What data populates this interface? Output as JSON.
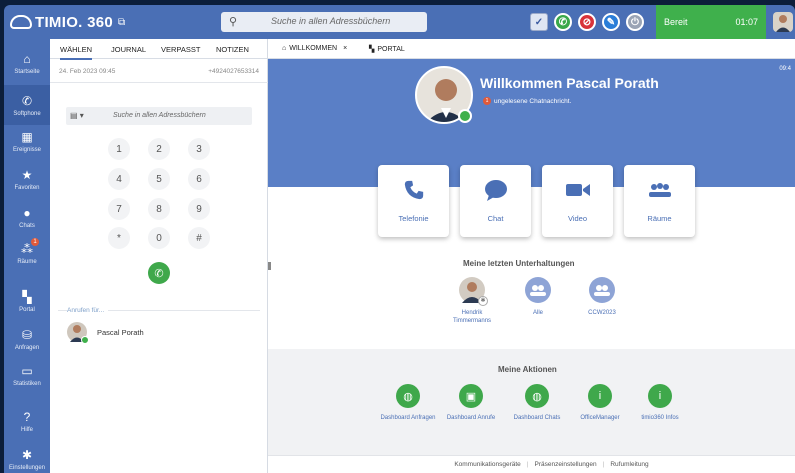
{
  "app": {
    "logo": "TIMIO. 360",
    "logo_ext_icon": "external-link-icon",
    "search_placeholder": "Suche in allen Adressbüchern"
  },
  "topbar": {
    "status_label": "Bereit",
    "timer": "01:07",
    "status_color": "#3fb04c",
    "bar_color": "#4a6fb5"
  },
  "nav": {
    "items": [
      {
        "label": "Startseite",
        "icon": "home-icon"
      },
      {
        "label": "Softphone",
        "icon": "phone-icon"
      },
      {
        "label": "Ereignisse",
        "icon": "calendar-icon"
      },
      {
        "label": "Favoriten",
        "icon": "star-icon"
      },
      {
        "label": "Chats",
        "icon": "chat-icon"
      },
      {
        "label": "Räume",
        "icon": "rooms-icon",
        "badge": "1"
      },
      {
        "label": "Portal",
        "icon": "grid-icon"
      },
      {
        "label": "Anfragen",
        "icon": "inbox-icon"
      },
      {
        "label": "Statistiken",
        "icon": "stats-icon"
      },
      {
        "label": "Hilfe",
        "icon": "help-icon"
      },
      {
        "label": "Einstellungen",
        "icon": "gear-icon"
      }
    ]
  },
  "dial": {
    "tabs": [
      "WÄHLEN",
      "JOURNAL",
      "VERPASST",
      "NOTIZEN"
    ],
    "last_date": "24. Feb 2023  09:45",
    "last_number": "+4924027653314",
    "search_placeholder": "Suche in allen Adressbüchern",
    "keys": [
      "1",
      "2",
      "3",
      "4",
      "5",
      "6",
      "7",
      "8",
      "9",
      "*",
      "0",
      "#"
    ],
    "call_for_label": "Anrufen für...",
    "call_for_name": "Pascal Porath"
  },
  "main": {
    "tabs": [
      {
        "label": "WILLKOMMEN",
        "icon": "home-icon",
        "close": "×"
      },
      {
        "label": "PORTAL",
        "icon": "grid-icon"
      }
    ],
    "time": "09:4",
    "welcome_title": "Willkommen Pascal Porath",
    "unread_badge": "1",
    "unread_text": "ungelesene Chatnachricht.",
    "cards": [
      {
        "label": "Telefonie",
        "icon": "phone-icon"
      },
      {
        "label": "Chat",
        "icon": "chat-bubble-icon"
      },
      {
        "label": "Video",
        "icon": "video-camera-icon"
      },
      {
        "label": "Räume",
        "icon": "group-icon"
      }
    ],
    "conversations_title": "Meine letzten Unterhaltungen",
    "conversations": [
      {
        "label": "Hendrik Timmermanns",
        "type": "person"
      },
      {
        "label": "Alle",
        "type": "group"
      },
      {
        "label": "CCW2023",
        "type": "group"
      }
    ],
    "actions_title": "Meine Aktionen",
    "actions": [
      {
        "label": "Dashboard Anfragen",
        "icon": "globe-icon"
      },
      {
        "label": "Dashboard Anrufe",
        "icon": "box-icon"
      },
      {
        "label": "Dashboard Chats",
        "icon": "globe-icon"
      },
      {
        "label": "OfficeManager",
        "icon": "info-icon"
      },
      {
        "label": "timio360 Infos",
        "icon": "info-icon"
      }
    ],
    "footer": [
      "Kommunikationsgeräte",
      "Präsenzeinstellungen",
      "Rufumleitung"
    ]
  }
}
